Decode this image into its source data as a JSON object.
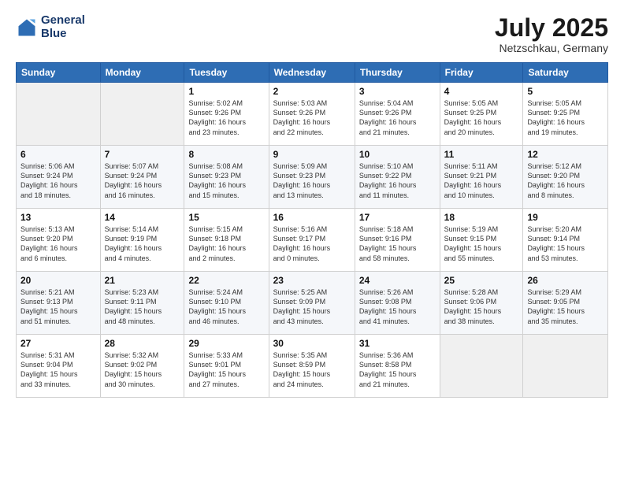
{
  "header": {
    "logo_line1": "General",
    "logo_line2": "Blue",
    "month": "July 2025",
    "location": "Netzschkau, Germany"
  },
  "days_of_week": [
    "Sunday",
    "Monday",
    "Tuesday",
    "Wednesday",
    "Thursday",
    "Friday",
    "Saturday"
  ],
  "weeks": [
    [
      {
        "day": "",
        "info": ""
      },
      {
        "day": "",
        "info": ""
      },
      {
        "day": "1",
        "info": "Sunrise: 5:02 AM\nSunset: 9:26 PM\nDaylight: 16 hours\nand 23 minutes."
      },
      {
        "day": "2",
        "info": "Sunrise: 5:03 AM\nSunset: 9:26 PM\nDaylight: 16 hours\nand 22 minutes."
      },
      {
        "day": "3",
        "info": "Sunrise: 5:04 AM\nSunset: 9:26 PM\nDaylight: 16 hours\nand 21 minutes."
      },
      {
        "day": "4",
        "info": "Sunrise: 5:05 AM\nSunset: 9:25 PM\nDaylight: 16 hours\nand 20 minutes."
      },
      {
        "day": "5",
        "info": "Sunrise: 5:05 AM\nSunset: 9:25 PM\nDaylight: 16 hours\nand 19 minutes."
      }
    ],
    [
      {
        "day": "6",
        "info": "Sunrise: 5:06 AM\nSunset: 9:24 PM\nDaylight: 16 hours\nand 18 minutes."
      },
      {
        "day": "7",
        "info": "Sunrise: 5:07 AM\nSunset: 9:24 PM\nDaylight: 16 hours\nand 16 minutes."
      },
      {
        "day": "8",
        "info": "Sunrise: 5:08 AM\nSunset: 9:23 PM\nDaylight: 16 hours\nand 15 minutes."
      },
      {
        "day": "9",
        "info": "Sunrise: 5:09 AM\nSunset: 9:23 PM\nDaylight: 16 hours\nand 13 minutes."
      },
      {
        "day": "10",
        "info": "Sunrise: 5:10 AM\nSunset: 9:22 PM\nDaylight: 16 hours\nand 11 minutes."
      },
      {
        "day": "11",
        "info": "Sunrise: 5:11 AM\nSunset: 9:21 PM\nDaylight: 16 hours\nand 10 minutes."
      },
      {
        "day": "12",
        "info": "Sunrise: 5:12 AM\nSunset: 9:20 PM\nDaylight: 16 hours\nand 8 minutes."
      }
    ],
    [
      {
        "day": "13",
        "info": "Sunrise: 5:13 AM\nSunset: 9:20 PM\nDaylight: 16 hours\nand 6 minutes."
      },
      {
        "day": "14",
        "info": "Sunrise: 5:14 AM\nSunset: 9:19 PM\nDaylight: 16 hours\nand 4 minutes."
      },
      {
        "day": "15",
        "info": "Sunrise: 5:15 AM\nSunset: 9:18 PM\nDaylight: 16 hours\nand 2 minutes."
      },
      {
        "day": "16",
        "info": "Sunrise: 5:16 AM\nSunset: 9:17 PM\nDaylight: 16 hours\nand 0 minutes."
      },
      {
        "day": "17",
        "info": "Sunrise: 5:18 AM\nSunset: 9:16 PM\nDaylight: 15 hours\nand 58 minutes."
      },
      {
        "day": "18",
        "info": "Sunrise: 5:19 AM\nSunset: 9:15 PM\nDaylight: 15 hours\nand 55 minutes."
      },
      {
        "day": "19",
        "info": "Sunrise: 5:20 AM\nSunset: 9:14 PM\nDaylight: 15 hours\nand 53 minutes."
      }
    ],
    [
      {
        "day": "20",
        "info": "Sunrise: 5:21 AM\nSunset: 9:13 PM\nDaylight: 15 hours\nand 51 minutes."
      },
      {
        "day": "21",
        "info": "Sunrise: 5:23 AM\nSunset: 9:11 PM\nDaylight: 15 hours\nand 48 minutes."
      },
      {
        "day": "22",
        "info": "Sunrise: 5:24 AM\nSunset: 9:10 PM\nDaylight: 15 hours\nand 46 minutes."
      },
      {
        "day": "23",
        "info": "Sunrise: 5:25 AM\nSunset: 9:09 PM\nDaylight: 15 hours\nand 43 minutes."
      },
      {
        "day": "24",
        "info": "Sunrise: 5:26 AM\nSunset: 9:08 PM\nDaylight: 15 hours\nand 41 minutes."
      },
      {
        "day": "25",
        "info": "Sunrise: 5:28 AM\nSunset: 9:06 PM\nDaylight: 15 hours\nand 38 minutes."
      },
      {
        "day": "26",
        "info": "Sunrise: 5:29 AM\nSunset: 9:05 PM\nDaylight: 15 hours\nand 35 minutes."
      }
    ],
    [
      {
        "day": "27",
        "info": "Sunrise: 5:31 AM\nSunset: 9:04 PM\nDaylight: 15 hours\nand 33 minutes."
      },
      {
        "day": "28",
        "info": "Sunrise: 5:32 AM\nSunset: 9:02 PM\nDaylight: 15 hours\nand 30 minutes."
      },
      {
        "day": "29",
        "info": "Sunrise: 5:33 AM\nSunset: 9:01 PM\nDaylight: 15 hours\nand 27 minutes."
      },
      {
        "day": "30",
        "info": "Sunrise: 5:35 AM\nSunset: 8:59 PM\nDaylight: 15 hours\nand 24 minutes."
      },
      {
        "day": "31",
        "info": "Sunrise: 5:36 AM\nSunset: 8:58 PM\nDaylight: 15 hours\nand 21 minutes."
      },
      {
        "day": "",
        "info": ""
      },
      {
        "day": "",
        "info": ""
      }
    ]
  ]
}
